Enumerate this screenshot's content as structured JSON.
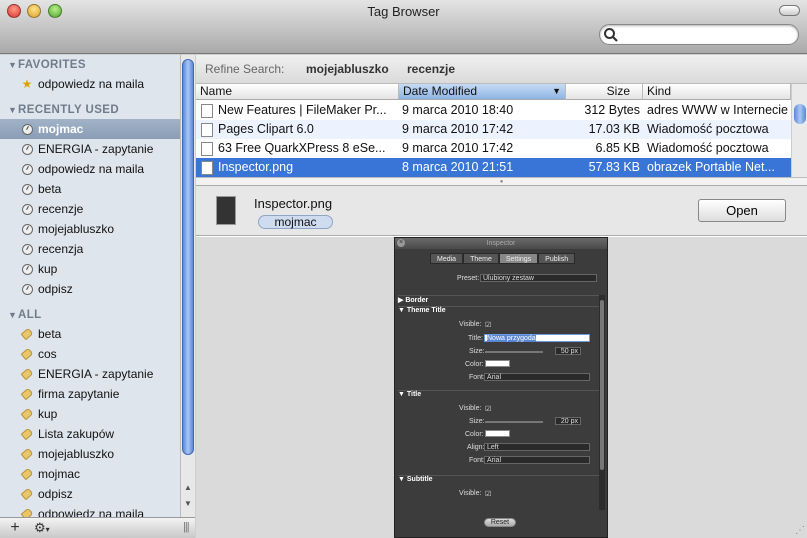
{
  "window": {
    "title": "Tag Browser"
  },
  "search": {
    "placeholder": "",
    "value": ""
  },
  "sidebar": {
    "favorites_label": "FAVORITES",
    "favorites": [
      "odpowiedz na maila"
    ],
    "recent_label": "RECENTLY USED",
    "recent": [
      "mojmac",
      "ENERGIA - zapytanie",
      "odpowiedz na maila",
      "beta",
      "recenzje",
      "mojejabluszko",
      "recenzja",
      "kup",
      "odpisz"
    ],
    "recent_selected": "mojmac",
    "all_label": "ALL",
    "all": [
      "beta",
      "cos",
      "ENERGIA - zapytanie",
      "firma zapytanie",
      "kup",
      "Lista zakupów",
      "mojejabluszko",
      "mojmac",
      "odpisz",
      "odpowiedz na maila"
    ]
  },
  "refine": {
    "label": "Refine Search:",
    "tags": [
      "mojejabluszko",
      "recenzje"
    ]
  },
  "table": {
    "columns": [
      "Name",
      "Date Modified",
      "Size",
      "Kind"
    ],
    "sorted_column": "Date Modified",
    "rows": [
      {
        "name": "New Features | FileMaker Pr...",
        "date": "9 marca 2010 18:40",
        "size": "312 Bytes",
        "kind": "adres WWW w Internecie"
      },
      {
        "name": "Pages Clipart 6.0",
        "date": "9 marca 2010 17:42",
        "size": "17.03 KB",
        "kind": "Wiadomość pocztowa"
      },
      {
        "name": "63 Free QuarkXPress 8 eSe...",
        "date": "9 marca 2010 17:42",
        "size": "6.85 KB",
        "kind": "Wiadomość pocztowa"
      },
      {
        "name": "Inspector.png",
        "date": "8 marca 2010 21:51",
        "size": "57.83 KB",
        "kind": "obrazek Portable Net..."
      }
    ],
    "selected_row": 3
  },
  "detail": {
    "filename": "Inspector.png",
    "tag": "mojmac",
    "open_label": "Open"
  },
  "inspector": {
    "title": "Inspector",
    "tabs": [
      "Media",
      "Theme",
      "Settings",
      "Publish"
    ],
    "active_tab": "Settings",
    "preset_label": "Preset:",
    "preset_value": "Ulubiony zestaw",
    "border_label": "Border",
    "theme_title_label": "Theme Title",
    "visible_label": "Visible:",
    "title_label": "Title:",
    "title_value": "Nowa przygoda",
    "size_label": "Size:",
    "size_value_1": "50 px",
    "color_label": "Color:",
    "font_label": "Font:",
    "font_value": "Arial",
    "title_section_label": "Title",
    "size_value_2": "20 px",
    "align_label": "Align:",
    "align_value": "Left",
    "subtitle_label": "Subtitle",
    "reset_label": "Reset"
  }
}
